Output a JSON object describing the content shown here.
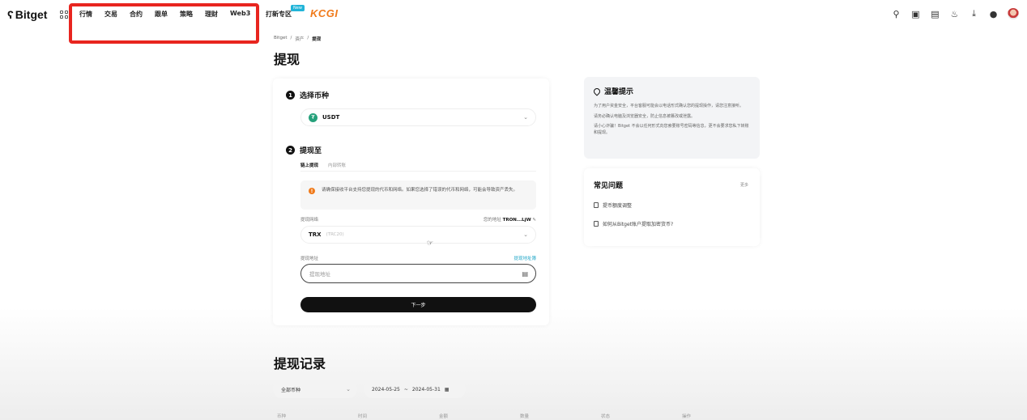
{
  "brand": {
    "logo_text": "Bitget"
  },
  "nav": {
    "items": [
      "行情",
      "交易",
      "合约",
      "跟单",
      "策略",
      "理财",
      "Web3"
    ],
    "extra": "打新专区",
    "new_badge": "New",
    "partner_logo": "KCGI"
  },
  "header_icons": [
    "search-icon",
    "wallet-icon",
    "orders-icon",
    "bell-icon",
    "download-icon",
    "globe-icon",
    "avatar"
  ],
  "breadcrumb": [
    "Bitget",
    "资产",
    "提现"
  ],
  "page_title": "提现",
  "step1": {
    "num": "1",
    "label": "选择币种",
    "coin": "USDT"
  },
  "step2": {
    "num": "2",
    "label": "提现至"
  },
  "tabs": [
    "链上提现",
    "内部转账"
  ],
  "notice": "请确保接收平台支持您提现的代币和网络。如果您选择了错误的代币和网络，可能会导致资产丢失。",
  "network": {
    "label": "提现网络",
    "right_label": "您的地址",
    "right_value": "TRON...LjW",
    "value": "TRX",
    "sub": "(TRC20)"
  },
  "address": {
    "label": "提现地址",
    "link": "提现地址簿",
    "placeholder": "提现地址"
  },
  "next_button": "下一步",
  "tips": {
    "title": "温馨提示",
    "lines": [
      "为了用户资金安全，平台客服可能会以电话形式确认您的提现操作，请您注意接听。",
      "请务必确认电脑及浏览器安全，防止信息被篡改或泄露。",
      "请小心诈骗！Bitget 不会以任何形式向您索要账号密码等信息，更不会要求您私下转账和提现。"
    ]
  },
  "faq": {
    "title": "常见问题",
    "more": "更多",
    "items": [
      "提币额度调整",
      "如何从Bitget账户提取加密货币?"
    ]
  },
  "history": {
    "title": "提现记录",
    "coin_filter": "全部币种",
    "date_from": "2024-05-25",
    "date_sep": "~",
    "date_to": "2024-05-31",
    "columns": [
      "币种",
      "时间",
      "金额",
      "数量",
      "状态",
      "操作"
    ]
  }
}
